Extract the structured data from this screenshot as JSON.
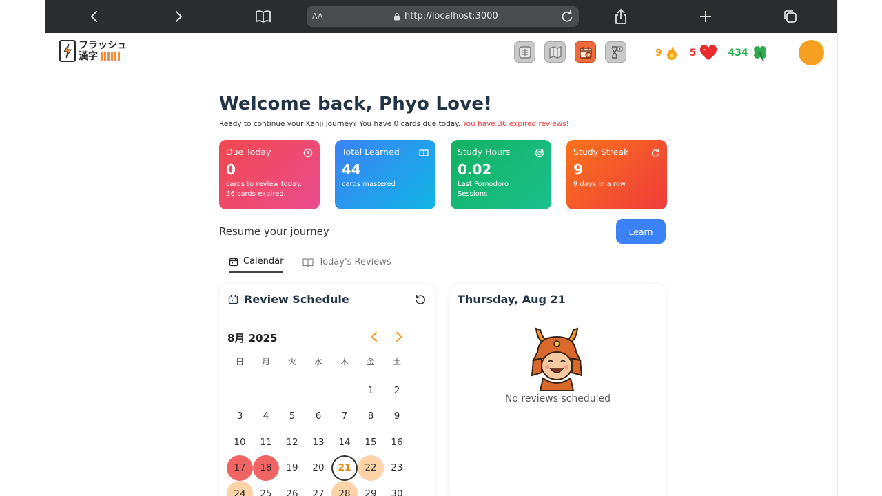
{
  "browser": {
    "aa_label": "AA",
    "url": "http://localhost:3000"
  },
  "logo": {
    "line1": "フラッシュ",
    "line2": "漢字"
  },
  "header_stats": {
    "streak": "9",
    "lives": "5",
    "clovers": "434",
    "colors": {
      "streak": "#f5a020",
      "lives": "#e53935",
      "clovers": "#22b14c"
    }
  },
  "welcome": {
    "title": "Welcome back, Phyo Love!",
    "subtitle": "Ready to continue your Kanji journey? You have 0 cards due today.",
    "warning": "You have 36 expired reviews!"
  },
  "cards": [
    {
      "title": "Due Today",
      "value": "0",
      "desc1": "cards to review today.",
      "desc2": "36 cards expired.",
      "icon": "clock-icon"
    },
    {
      "title": "Total Learned",
      "value": "44",
      "desc1": "cards mastered",
      "desc2": "",
      "icon": "book-icon"
    },
    {
      "title": "Study Hours",
      "value": "0.02",
      "desc1": "Last Pomodoro",
      "desc2": "Sessions",
      "icon": "target-icon"
    },
    {
      "title": "Study Streak",
      "value": "9",
      "desc1": "9 days in a row",
      "desc2": "",
      "icon": "refresh-icon"
    }
  ],
  "resume": {
    "label": "Resume your journey",
    "button": "Learn"
  },
  "tabs": [
    {
      "label": "Calendar",
      "active": true
    },
    {
      "label": "Today's Reviews",
      "active": false
    }
  ],
  "calendar": {
    "title": "Review Schedule",
    "month": "8月 2025",
    "weekdays": [
      "日",
      "月",
      "火",
      "水",
      "木",
      "金",
      "土"
    ],
    "weeks": [
      [
        "",
        "",
        "",
        "",
        "",
        "1",
        "2"
      ],
      [
        "3",
        "4",
        "5",
        "6",
        "7",
        "8",
        "9"
      ],
      [
        "10",
        "11",
        "12",
        "13",
        "14",
        "15",
        "16"
      ],
      [
        "17",
        "18",
        "19",
        "20",
        "21",
        "22",
        "23"
      ],
      [
        "24",
        "25",
        "26",
        "27",
        "28",
        "29",
        "30"
      ]
    ],
    "expired_days": [
      "17",
      "18"
    ],
    "scheduled_days": [
      "22",
      "24",
      "28"
    ],
    "today": "21"
  },
  "day_panel": {
    "date": "Thursday, Aug 21",
    "empty_text": "No reviews scheduled"
  }
}
